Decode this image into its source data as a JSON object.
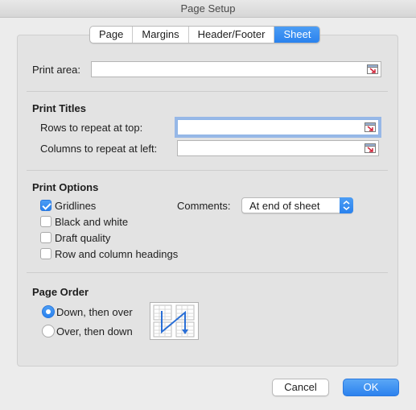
{
  "window": {
    "title": "Page Setup"
  },
  "tabs": [
    {
      "label": "Page",
      "active": false
    },
    {
      "label": "Margins",
      "active": false
    },
    {
      "label": "Header/Footer",
      "active": false
    },
    {
      "label": "Sheet",
      "active": true
    }
  ],
  "print_area": {
    "label": "Print area:",
    "value": ""
  },
  "print_titles": {
    "heading": "Print Titles",
    "rows_label": "Rows to repeat at top:",
    "rows_value": "",
    "cols_label": "Columns to repeat at left:",
    "cols_value": ""
  },
  "print_options": {
    "heading": "Print Options",
    "gridlines": {
      "label": "Gridlines",
      "checked": true
    },
    "black_white": {
      "label": "Black and white",
      "checked": false
    },
    "draft": {
      "label": "Draft quality",
      "checked": false
    },
    "headings": {
      "label": "Row and column headings",
      "checked": false
    },
    "comments_label": "Comments:",
    "comments_value": "At end of sheet"
  },
  "page_order": {
    "heading": "Page Order",
    "down_over": {
      "label": "Down, then over",
      "selected": true
    },
    "over_down": {
      "label": "Over, then down",
      "selected": false
    }
  },
  "buttons": {
    "cancel": "Cancel",
    "ok": "OK"
  },
  "colors": {
    "accent": "#2a82ee",
    "background": "#ececec"
  },
  "icons": {
    "field_button": "collapse-dialog-icon",
    "popup_button": "up-down-chevron-icon",
    "page_order": "page-order-down-over-icon"
  }
}
